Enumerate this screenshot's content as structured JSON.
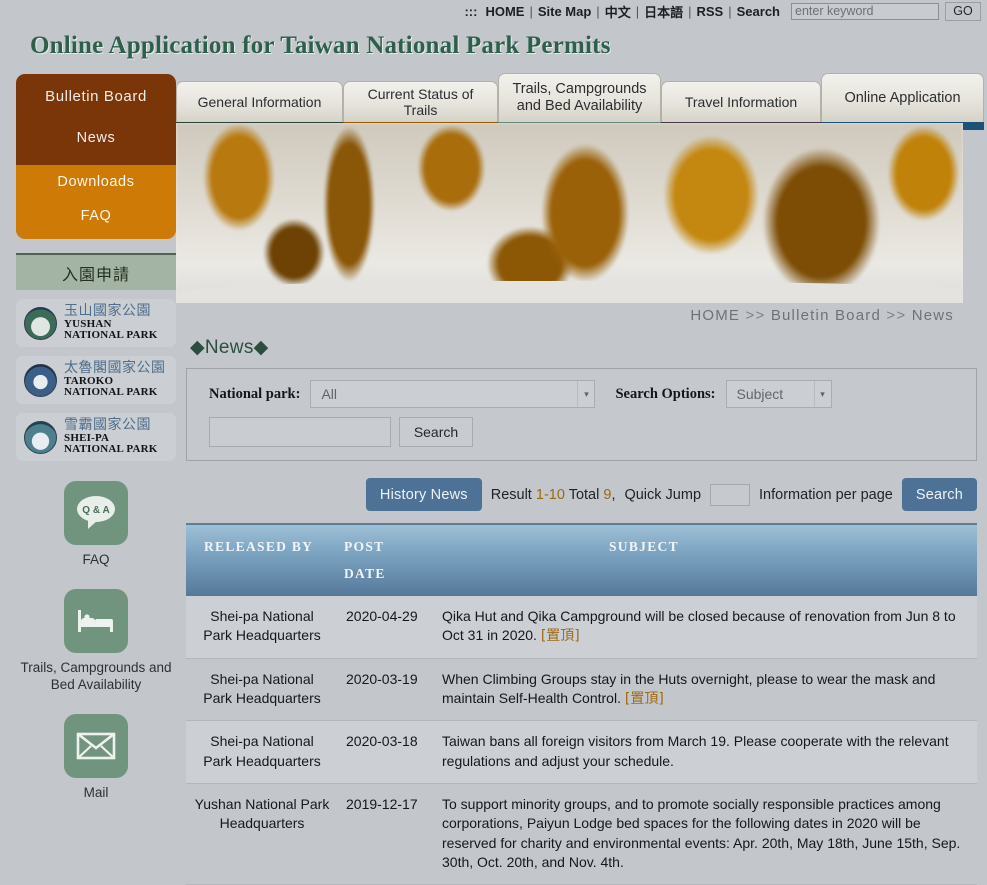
{
  "topbar": {
    "accessibility_mark": ":::",
    "links": [
      "HOME",
      "Site Map",
      "中文",
      "日本語",
      "RSS",
      "Search"
    ],
    "separator": "|",
    "search_placeholder": "enter keyword",
    "search_value": "",
    "go_label": "GO"
  },
  "site": {
    "title": "Online Application for Taiwan National Park Permits"
  },
  "sidebar": {
    "bulletin_title": "Bulletin Board",
    "bulletin_items": [
      "News"
    ],
    "submenu_items": [
      "Downloads",
      "FAQ"
    ],
    "apply_label": "入園申請",
    "parks": [
      {
        "cn": "玉山國家公園",
        "en_line1": "YUSHAN",
        "en_line2": "NATIONAL PARK",
        "seal": "yushan-seal-icon"
      },
      {
        "cn": "太魯閣國家公園",
        "en_line1": "TAROKO",
        "en_line2": "NATIONAL PARK",
        "seal": "taroko-seal-icon"
      },
      {
        "cn": "雪霸國家公園",
        "en_line1": "SHEI-PA",
        "en_line2": "NATIONAL PARK",
        "seal": "sheipa-seal-icon"
      }
    ],
    "shortcuts": [
      {
        "icon": "question-answer-bubble-icon",
        "icon_text": "Q & A",
        "label": "FAQ"
      },
      {
        "icon": "bed-icon",
        "label": "Trails, Campgrounds and Bed Availability"
      },
      {
        "icon": "envelope-icon",
        "label": "Mail"
      }
    ]
  },
  "tabs": [
    {
      "label": "General Information",
      "color": "#2c4239",
      "active": false
    },
    {
      "label": "Current Status of Trails",
      "color": "#9a5a04",
      "active": false
    },
    {
      "label": "Trails, Campgrounds and Bed Availability",
      "color": "#65897f",
      "active": false
    },
    {
      "label": "Travel Information",
      "color": "#4c3646",
      "active": false
    },
    {
      "label": "Online Application",
      "color": "#1d5278",
      "active": true
    }
  ],
  "breadcrumb": {
    "items": [
      "HOME",
      "Bulletin Board",
      "News"
    ],
    "separator": ">>"
  },
  "page": {
    "title": "◆News◆"
  },
  "search_panel": {
    "national_park_label": "National park:",
    "national_park_value": "All",
    "search_options_label": "Search Options:",
    "search_options_value": "Subject",
    "keyword_value": "",
    "search_button": "Search"
  },
  "result_bar": {
    "history_button": "History News",
    "result_prefix": "Result",
    "result_range": "1-10",
    "total_prefix": "Total",
    "total_count": "9",
    "total_suffix": ",",
    "quick_jump_label": "Quick Jump",
    "quick_jump_value": "",
    "per_page_label": "Information per page",
    "search_button": "Search"
  },
  "table": {
    "headers": [
      "RELEASED BY",
      "POST DATE",
      "SUBJECT"
    ],
    "header_date_line1": "POST",
    "header_date_line2": "DATE",
    "rows": [
      {
        "released_by": "Shei-pa National Park Headquarters",
        "post_date": "2020-04-29",
        "subject": "Qika Hut and Qika Campground will be closed because of renovation from Jun 8 to Oct 31 in 2020.",
        "tag": "[置頂]"
      },
      {
        "released_by": "Shei-pa National Park Headquarters",
        "post_date": "2020-03-19",
        "subject": "When Climbing Groups stay in the Huts overnight, please to wear the mask and maintain Self-Health Control.",
        "tag": "[置頂]"
      },
      {
        "released_by": "Shei-pa National Park Headquarters",
        "post_date": "2020-03-18",
        "subject": "Taiwan bans all foreign visitors from March 19. Please cooperate with the relevant regulations and adjust your schedule.",
        "tag": ""
      },
      {
        "released_by": "Yushan National Park Headquarters",
        "post_date": "2019-12-17",
        "subject": "To support minority groups, and to promote socially responsible practices among corporations, Paiyun Lodge bed spaces for the following dates in 2020 will be reserved for charity and environmental events: Apr. 20th, May 18th, June 15th, Sep. 30th, Oct. 20th, and Nov. 4th.",
        "tag": ""
      }
    ]
  }
}
